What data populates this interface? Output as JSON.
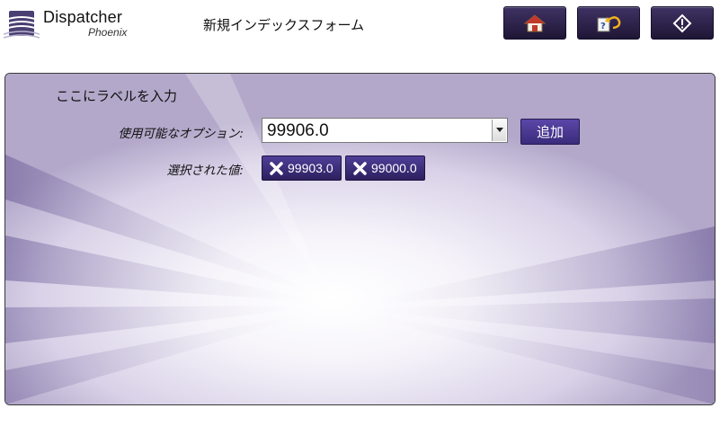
{
  "app": {
    "brand_main": "Dispatcher",
    "brand_sub": "Phoenix"
  },
  "header": {
    "title": "新規インデックスフォーム",
    "buttons": [
      {
        "icon": "home-icon"
      },
      {
        "icon": "index-undo-icon"
      },
      {
        "icon": "info-diamond-icon"
      }
    ]
  },
  "form": {
    "label": "ここにラベルを入力",
    "available_label": "使用可能なオプション:",
    "selected_value": "99906.0",
    "add_label": "追加",
    "selected_label": "選択された値:",
    "chips": [
      "99903.0",
      "99000.0"
    ]
  },
  "colors": {
    "button_dark": "#2a1f47",
    "chip": "#3b2d7a",
    "accent": "#4a3a9a"
  }
}
